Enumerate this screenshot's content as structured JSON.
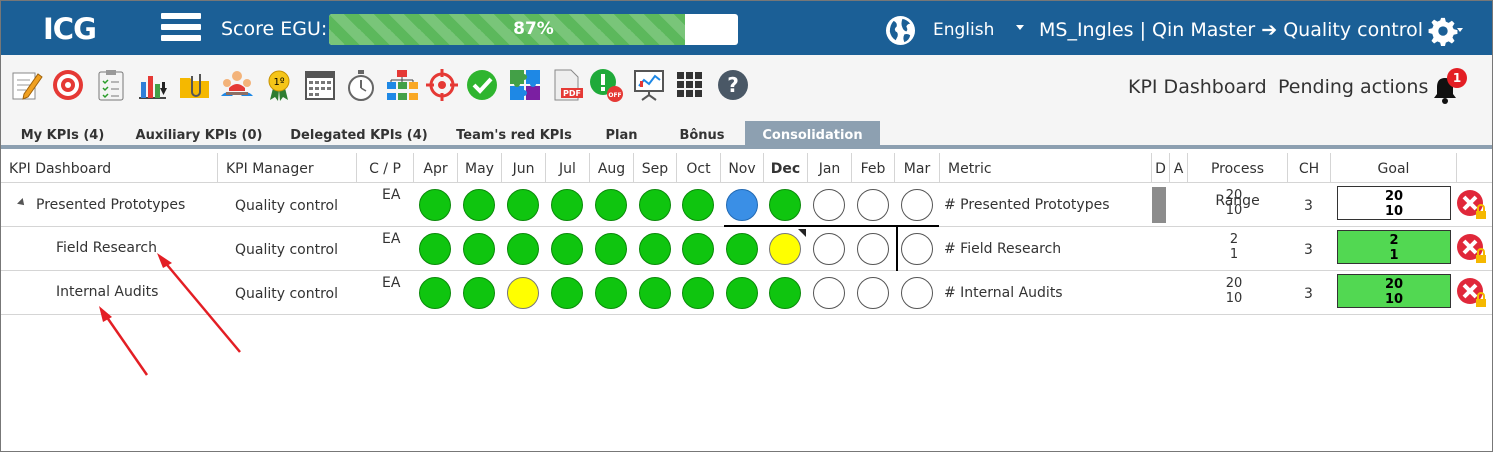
{
  "header": {
    "logo": "ICG",
    "score_label": "Score EGU:",
    "score_value": 0.87,
    "score_text": "87%",
    "language": "English",
    "user": "MS_Ingles  |  Qin Master ➔ Quality control",
    "brand_color": "#1b5f96"
  },
  "toolbar": {
    "icons": [
      "edit-icon",
      "target-icon",
      "checklist-icon",
      "chart-down-icon",
      "paperclip-icon",
      "team-icon",
      "medal-icon",
      "calendar-icon",
      "stopwatch-icon",
      "org-chart-icon",
      "crosshair-icon",
      "check-circle-icon",
      "puzzle-icon",
      "pdf-icon",
      "alert-off-icon",
      "presentation-icon",
      "grid-icon",
      "help-icon"
    ],
    "kpi_dashboard": "KPI Dashboard",
    "pending_actions": "Pending actions",
    "notification_count": "1"
  },
  "tabs": [
    {
      "label": "My KPIs (4)"
    },
    {
      "label": "Auxiliary KPIs (0)"
    },
    {
      "label": "Delegated KPIs (4)"
    },
    {
      "label": "Team's red KPIs"
    },
    {
      "label": "Plan"
    },
    {
      "label": "Bônus"
    },
    {
      "label": "Consolidation",
      "active": true
    }
  ],
  "columns": {
    "dashboard": "KPI Dashboard",
    "manager": "KPI Manager",
    "cp": "C / P",
    "months": [
      "Apr",
      "May",
      "Jun",
      "Jul",
      "Aug",
      "Sep",
      "Oct",
      "Nov",
      "Dec",
      "Jan",
      "Feb",
      "Mar"
    ],
    "metric": "Metric",
    "d": "D",
    "a": "A",
    "process_range": "Process Range",
    "ch": "CH",
    "goal": "Goal"
  },
  "rows": [
    {
      "name": "Presented Prototypes",
      "manager": "Quality control",
      "cp": "EA",
      "status": [
        "green",
        "green",
        "green",
        "green",
        "green",
        "green",
        "green",
        "blue",
        "green",
        "empty",
        "empty",
        "empty"
      ],
      "metric": "# Presented Prototypes",
      "range": [
        "20",
        "10"
      ],
      "ch": "3",
      "goal": [
        "20",
        "10"
      ],
      "goal_style": "white"
    },
    {
      "name": "Field Research",
      "manager": "Quality control",
      "cp": "EA",
      "status": [
        "green",
        "green",
        "green",
        "green",
        "green",
        "green",
        "green",
        "green",
        "yellow",
        "empty",
        "empty",
        "empty"
      ],
      "metric": "# Field Research",
      "range": [
        "2",
        "1"
      ],
      "ch": "3",
      "goal": [
        "2",
        "1"
      ],
      "goal_style": "green"
    },
    {
      "name": "Internal Audits",
      "manager": "Quality control",
      "cp": "EA",
      "status": [
        "green",
        "green",
        "yellow",
        "green",
        "green",
        "green",
        "green",
        "green",
        "green",
        "empty",
        "empty",
        "empty"
      ],
      "metric": "# Internal Audits",
      "range": [
        "20",
        "10"
      ],
      "ch": "3",
      "goal": [
        "20",
        "10"
      ],
      "goal_style": "green"
    }
  ],
  "colors": {
    "green": "#0fc50f",
    "blue": "#3a8fe6",
    "yellow": "#ffff00",
    "goal_green": "#52d852",
    "tab_active": "#8da0b1",
    "annotation": "#e31e24"
  }
}
